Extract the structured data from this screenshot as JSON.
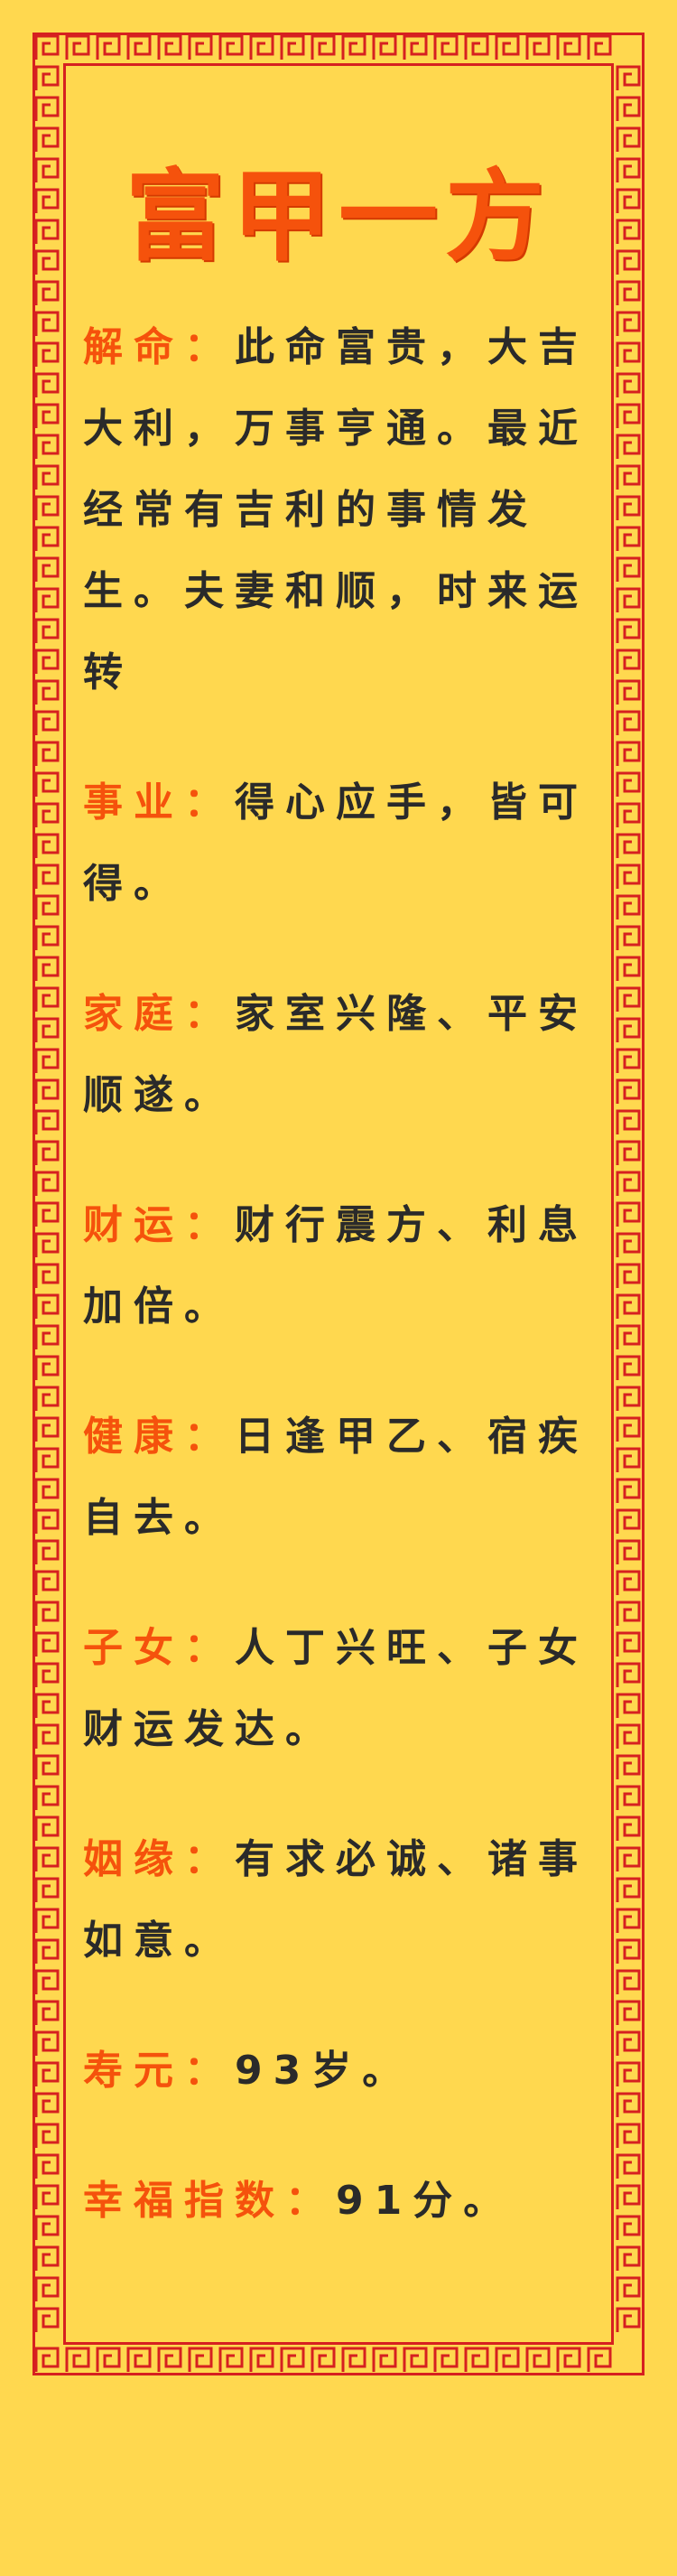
{
  "title": "富甲一方",
  "sections": [
    {
      "label": "解命：",
      "text": "此命富贵，大吉大利，万事亨通。最近经常有吉利的事情发生。夫妻和顺，时来运转"
    },
    {
      "label": "事业：",
      "text": "得心应手，皆可得。"
    },
    {
      "label": "家庭：",
      "text": "家室兴隆、平安顺遂。"
    },
    {
      "label": "财运：",
      "text": "财行震方、利息加倍。"
    },
    {
      "label": "健康：",
      "text": "日逢甲乙、宿疾自去。"
    },
    {
      "label": "子女：",
      "text": "人丁兴旺、子女财运发达。"
    },
    {
      "label": "姻缘：",
      "text": "有求必诚、诸事如意。"
    },
    {
      "label": "寿元：",
      "text": "93岁。"
    },
    {
      "label": "幸福指数：",
      "text": "91分。"
    }
  ],
  "colors": {
    "background": "#FFD84F",
    "accent": "#F5520C",
    "border": "#D62020",
    "text": "#2A2A2A"
  }
}
